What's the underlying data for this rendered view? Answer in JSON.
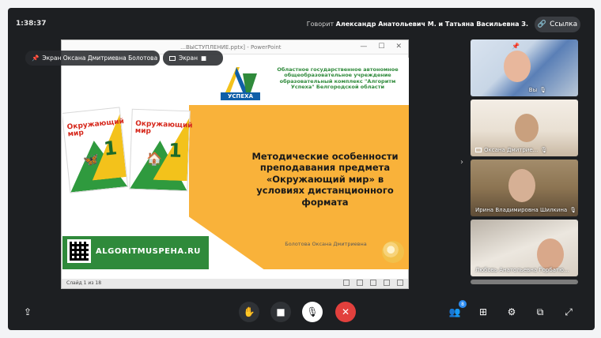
{
  "top_bar": {
    "time": "1:38:37",
    "speaking_prefix": "Говорит",
    "speaking_names": "Александр Анатольевич М. и Татьяна Васильевна З.",
    "link_label": "Ссылка"
  },
  "presenter_chips": {
    "screen_label": "Экран Оксана Дмитриевна Болотова",
    "screen2_label": "Экран"
  },
  "powerpoint": {
    "title": "…ВЫСТУПЛЕНИЕ.pptx] - PowerPoint",
    "status": "Слайд 1 из 18"
  },
  "slide": {
    "org_text": "Областное государственное автономное общеобразовательное учреждение образовательный комплекс \"Алгоритм Успеха\" Белгородской области",
    "logo_word": "УСПЕХА",
    "headline": "Методические особенности преподавания предмета «Окружающий мир» в условиях дистанционного формата",
    "author": "Болотова Оксана Дмитриевна",
    "website": "ALGORITMUSPEHA.RU",
    "book1": {
      "title": "Окружающий мир",
      "number": "1"
    },
    "book2": {
      "title": "Окружающий мир",
      "number": "1"
    }
  },
  "participants": [
    {
      "label": "Вы"
    },
    {
      "label": "Оксана Дмитрие..."
    },
    {
      "label": "Ирина Владимировна Шилкина"
    },
    {
      "label": "Любовь Анатольевна Горбатю..."
    }
  ],
  "controls": {
    "participants_badge": "8"
  }
}
